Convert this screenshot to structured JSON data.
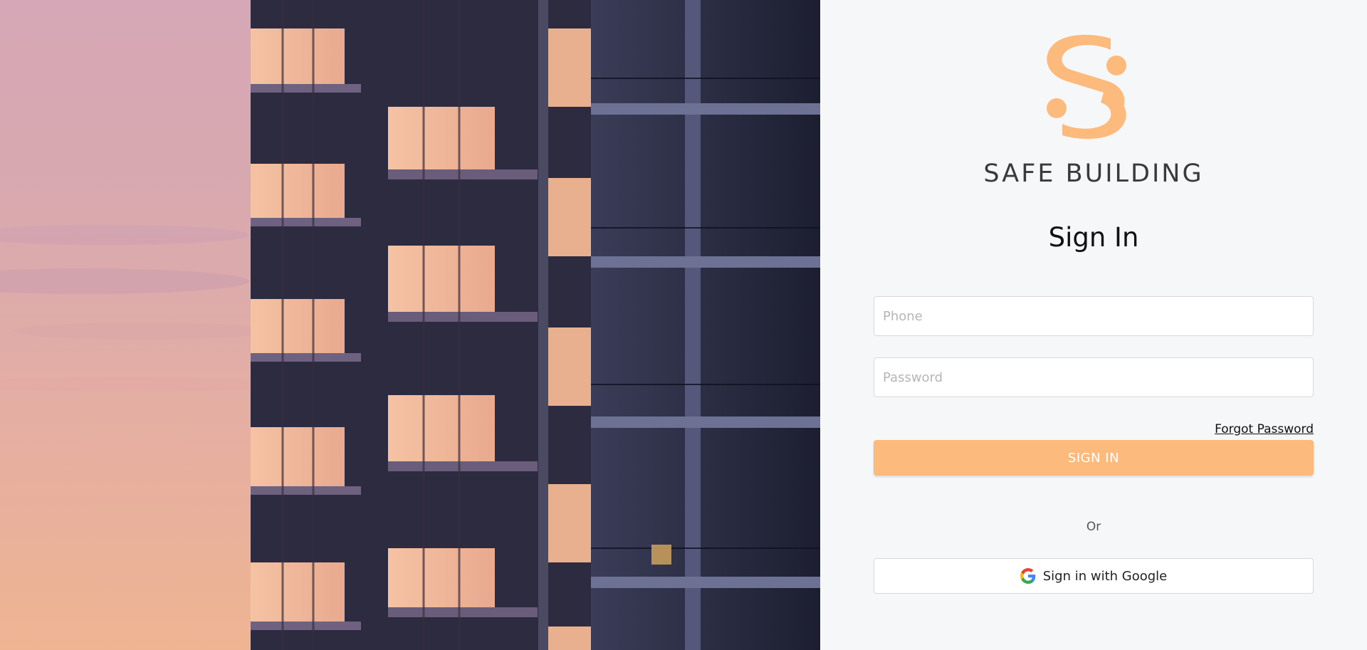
{
  "brand": {
    "name": "SAFE BUILDING",
    "logo_icon": "s-logo-icon",
    "accent_color": "#fdba7d"
  },
  "hero": {
    "image": "building-balconies-at-sunset"
  },
  "form": {
    "title": "Sign In",
    "phone_placeholder": "Phone",
    "password_placeholder": "Password",
    "forgot_label": "Forgot Password",
    "submit_label": "SIGN IN",
    "divider_label": "Or",
    "google_label": "Sign in with Google",
    "google_icon": "google-g-icon"
  }
}
